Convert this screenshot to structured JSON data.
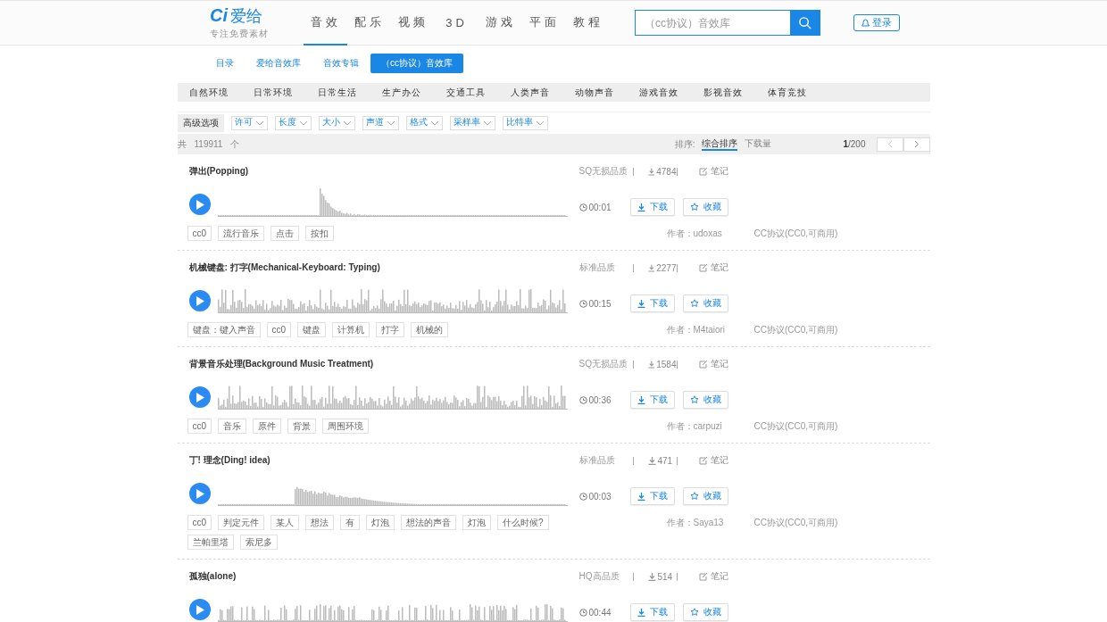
{
  "logo": {
    "mark": "Ci",
    "name": "爱给",
    "slogan": "专注免费素材"
  },
  "nav": [
    {
      "label": "音效",
      "selected": true
    },
    {
      "label": "配乐",
      "selected": false
    },
    {
      "label": "视频",
      "selected": false
    },
    {
      "label": "3D",
      "selected": false
    },
    {
      "label": "游戏",
      "selected": false
    },
    {
      "label": "平面",
      "selected": false
    },
    {
      "label": "教程",
      "selected": false
    }
  ],
  "search": {
    "placeholder": "（cc协议）音效库"
  },
  "login": "登录",
  "subnav": [
    {
      "label": "目录",
      "selected": false
    },
    {
      "label": "爱给音效库",
      "selected": false
    },
    {
      "label": "音效专辑",
      "selected": false
    },
    {
      "label": "（cc协议）音效库",
      "selected": true
    }
  ],
  "categories": [
    "自然环境",
    "日常环境",
    "日常生活",
    "生产办公",
    "交通工具",
    "人类声音",
    "动物声音",
    "游戏音效",
    "影视音效",
    "体育竞技"
  ],
  "filters": {
    "label": "高级选项",
    "options": [
      "许可",
      "长度",
      "大小",
      "声道",
      "格式",
      "采样率",
      "比特率"
    ]
  },
  "summary": {
    "prefix": "共",
    "count": "119911",
    "suffix": "个",
    "sort_label": "排序:",
    "sorts": [
      {
        "label": "综合排序",
        "selected": true
      },
      {
        "label": "下载量",
        "selected": false
      }
    ],
    "page": "1",
    "pages": "/200"
  },
  "sounds": [
    {
      "title": "弹出(Popping)",
      "quality": "SQ无损品质",
      "downloads": "4784",
      "notes": "笔记",
      "duration": "00:01",
      "download": "下载",
      "collect": "收藏",
      "tags": [
        "cc0",
        "流行音乐",
        "点击",
        "按扣"
      ],
      "author": "作者：udoxas",
      "license": "CC协议(CC0,可商用)"
    },
    {
      "title": "机械键盘: 打字(Mechanical-Keyboard: Typing)",
      "quality": "标准品质",
      "downloads": "2277",
      "notes": "笔记",
      "duration": "00:15",
      "download": "下载",
      "collect": "收藏",
      "tags": [
        "键盘：键入声音",
        "cc0",
        "键盘",
        "计算机",
        "打字",
        "机械的"
      ],
      "author": "作者：M4taiori",
      "license": "CC协议(CC0,可商用)"
    },
    {
      "title": "背景音乐处理(Background Music Treatment)",
      "quality": "SQ无损品质",
      "downloads": "1584",
      "notes": "笔记",
      "duration": "00:36",
      "download": "下载",
      "collect": "收藏",
      "tags": [
        "cc0",
        "音乐",
        "原件",
        "背景",
        "周围环境"
      ],
      "author": "作者：carpuzi",
      "license": "CC协议(CC0,可商用)"
    },
    {
      "title": "丁! 理念(Ding! idea)",
      "quality": "标准品质",
      "downloads": "471",
      "notes": "笔记",
      "duration": "00:03",
      "download": "下载",
      "collect": "收藏",
      "tags": [
        "cc0",
        "判定元件",
        "某人",
        "想法",
        "有",
        "灯泡",
        "想法的声音",
        "灯泡",
        "什么时候?",
        "兰帕里塔",
        "索尼多"
      ],
      "author": "作者：Saya13",
      "license": "CC协议(CC0,可商用)"
    },
    {
      "title": "孤独(alone)",
      "quality": "HQ高品质",
      "downloads": "514",
      "notes": "笔记",
      "duration": "00:44",
      "download": "下载",
      "collect": "收藏"
    }
  ]
}
